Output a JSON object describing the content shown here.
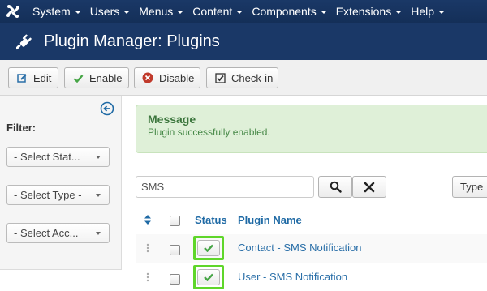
{
  "nav": {
    "menus": [
      {
        "label": "System"
      },
      {
        "label": "Users"
      },
      {
        "label": "Menus"
      },
      {
        "label": "Content"
      },
      {
        "label": "Components"
      },
      {
        "label": "Extensions"
      },
      {
        "label": "Help"
      }
    ]
  },
  "header": {
    "title": "Plugin Manager: Plugins",
    "icon": "plug-icon"
  },
  "toolbar": {
    "edit": "Edit",
    "enable": "Enable",
    "disable": "Disable",
    "checkin": "Check-in"
  },
  "sidebar": {
    "filter_label": "Filter:",
    "selects": [
      {
        "value": "- Select Stat..."
      },
      {
        "value": "- Select Type -"
      },
      {
        "value": "- Select Acc..."
      }
    ]
  },
  "message": {
    "title": "Message",
    "text": "Plugin successfully enabled."
  },
  "search": {
    "value": "SMS",
    "type_label": "Type"
  },
  "table": {
    "headers": {
      "status": "Status",
      "name": "Plugin Name"
    },
    "rows": [
      {
        "name": "Contact - SMS Notification",
        "status": "enabled"
      },
      {
        "name": "User - SMS Notification",
        "status": "enabled"
      }
    ]
  },
  "colors": {
    "nav_bg": "#1a3867",
    "link": "#2a6fa8",
    "success_bg": "#dff0d8",
    "highlight": "#5fd62a",
    "check_green": "#46a546",
    "disable_red": "#c0392b"
  }
}
